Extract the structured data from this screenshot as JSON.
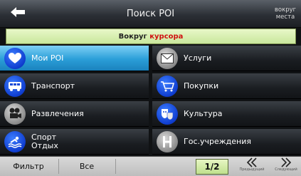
{
  "header": {
    "title": "Поиск POI",
    "back_icon": "arrow-left-icon",
    "near_label_line1": "вокруг",
    "near_label_line2": "места"
  },
  "reference": {
    "prefix": "Вокруг",
    "highlight": "курсора",
    "highlight_color": "#d01010"
  },
  "categories": [
    {
      "label": "Мои POI",
      "icon": "heart-icon",
      "selected": true
    },
    {
      "label": "Услуги",
      "icon": "envelope-icon",
      "selected": false
    },
    {
      "label": "Транспорт",
      "icon": "bus-icon",
      "selected": false
    },
    {
      "label": "Покупки",
      "icon": "shopping-cart-icon",
      "selected": false
    },
    {
      "label": "Развлечения",
      "icon": "film-camera-icon",
      "selected": false
    },
    {
      "label": "Культура",
      "icon": "theater-masks-icon",
      "selected": false
    },
    {
      "label_line1": "Спорт",
      "label_line2": "Отдых",
      "icon": "swimmer-icon",
      "selected": false
    },
    {
      "label": "Гос.учреждения",
      "icon": "letter-h-icon",
      "selected": false
    }
  ],
  "footer": {
    "filter_label": "Фильтр",
    "all_label": "Все",
    "page_indicator": "1/2",
    "prev_caption": "Предыдущий",
    "next_caption": "Следующий"
  },
  "colors": {
    "selected_row": "#2a9ed8",
    "reference_bar": "#c9e79c",
    "icon_blue": "#0f3dcf"
  }
}
